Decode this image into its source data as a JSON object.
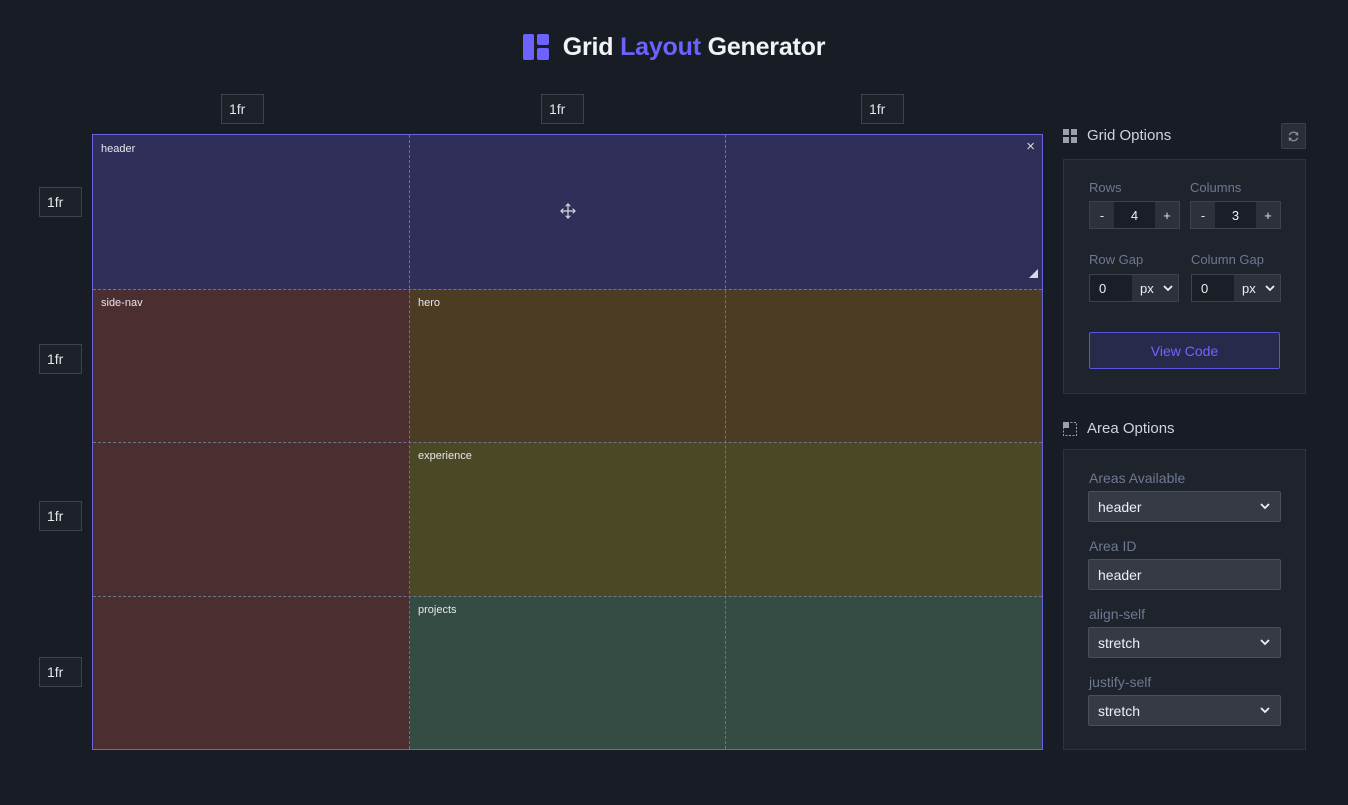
{
  "title": {
    "part1": "Grid",
    "accent": "Layout",
    "part2": "Generator"
  },
  "columns_sizes": [
    "1fr",
    "1fr",
    "1fr"
  ],
  "row_sizes": [
    "1fr",
    "1fr",
    "1fr",
    "1fr"
  ],
  "areas": [
    {
      "name": "header",
      "color": "#2f2f5a"
    },
    {
      "name": "side-nav",
      "color": "#4b2e30"
    },
    {
      "name": "hero",
      "color": "#4c3c24"
    },
    {
      "name": "experience",
      "color": "#4a4825"
    },
    {
      "name": "projects",
      "color": "#344c43"
    }
  ],
  "grid_options": {
    "title": "Grid Options",
    "rows_label": "Rows",
    "rows_value": "4",
    "columns_label": "Columns",
    "columns_value": "3",
    "minus": "-",
    "plus": "+",
    "row_gap_label": "Row Gap",
    "row_gap_value": "0",
    "row_gap_unit": "px",
    "column_gap_label": "Column Gap",
    "column_gap_value": "0",
    "column_gap_unit": "px",
    "view_code": "View Code"
  },
  "area_options": {
    "title": "Area Options",
    "areas_available_label": "Areas Available",
    "areas_available_value": "header",
    "area_id_label": "Area ID",
    "area_id_value": "header",
    "align_self_label": "align-self",
    "align_self_value": "stretch",
    "justify_self_label": "justify-self",
    "justify_self_value": "stretch"
  },
  "icons": {
    "logo": "grid-layout-icon",
    "close": "×",
    "move": "move-icon",
    "resize": "resize-handle-icon",
    "refresh": "refresh-icon",
    "grid_options": "grid-options-icon",
    "area_options": "area-options-icon",
    "chevron": "chevron-down-icon"
  }
}
